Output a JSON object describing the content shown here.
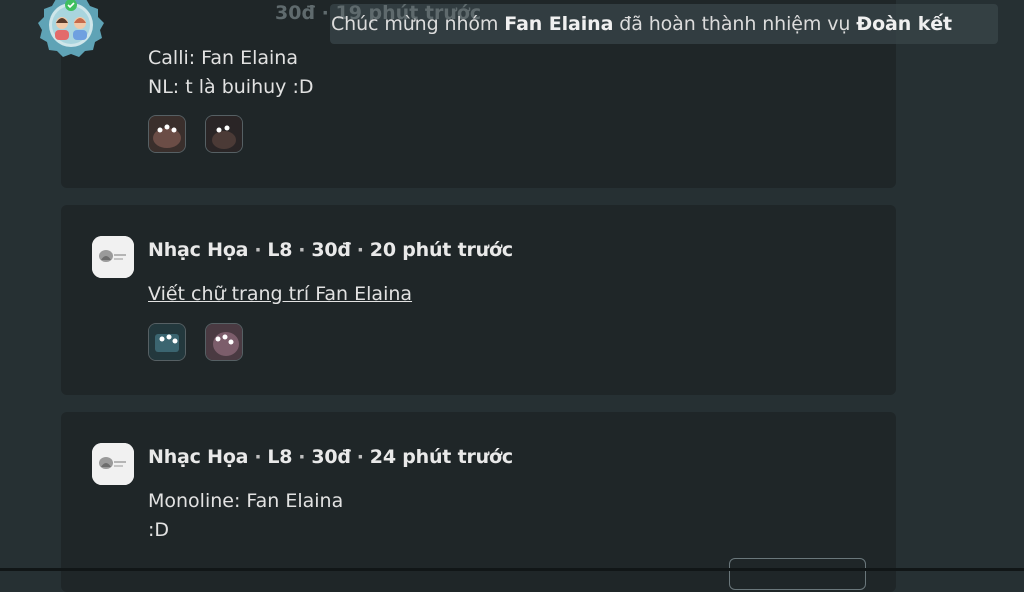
{
  "toast": {
    "prefix": "Chúc mừng nhóm ",
    "group": "Fan Elaina",
    "middle": " đã hoàn thành nhiệm vụ ",
    "mission": "Đoàn kết"
  },
  "top_card": {
    "meta_faded": "30đ · 19 phút trước",
    "lines": [
      "Calli: Fan Elaina",
      "NL: t là buihuy :D"
    ]
  },
  "posts": [
    {
      "author": "Nhạc Họa",
      "level": "L8",
      "points": "30đ",
      "time": "20 phút trước",
      "link_text": "Viết chữ trang trí Fan Elaina"
    },
    {
      "author": "Nhạc Họa",
      "level": "L8",
      "points": "30đ",
      "time": "24 phút trước",
      "lines": [
        "Monoline: Fan Elaina",
        ":D"
      ]
    }
  ],
  "separator": "·"
}
